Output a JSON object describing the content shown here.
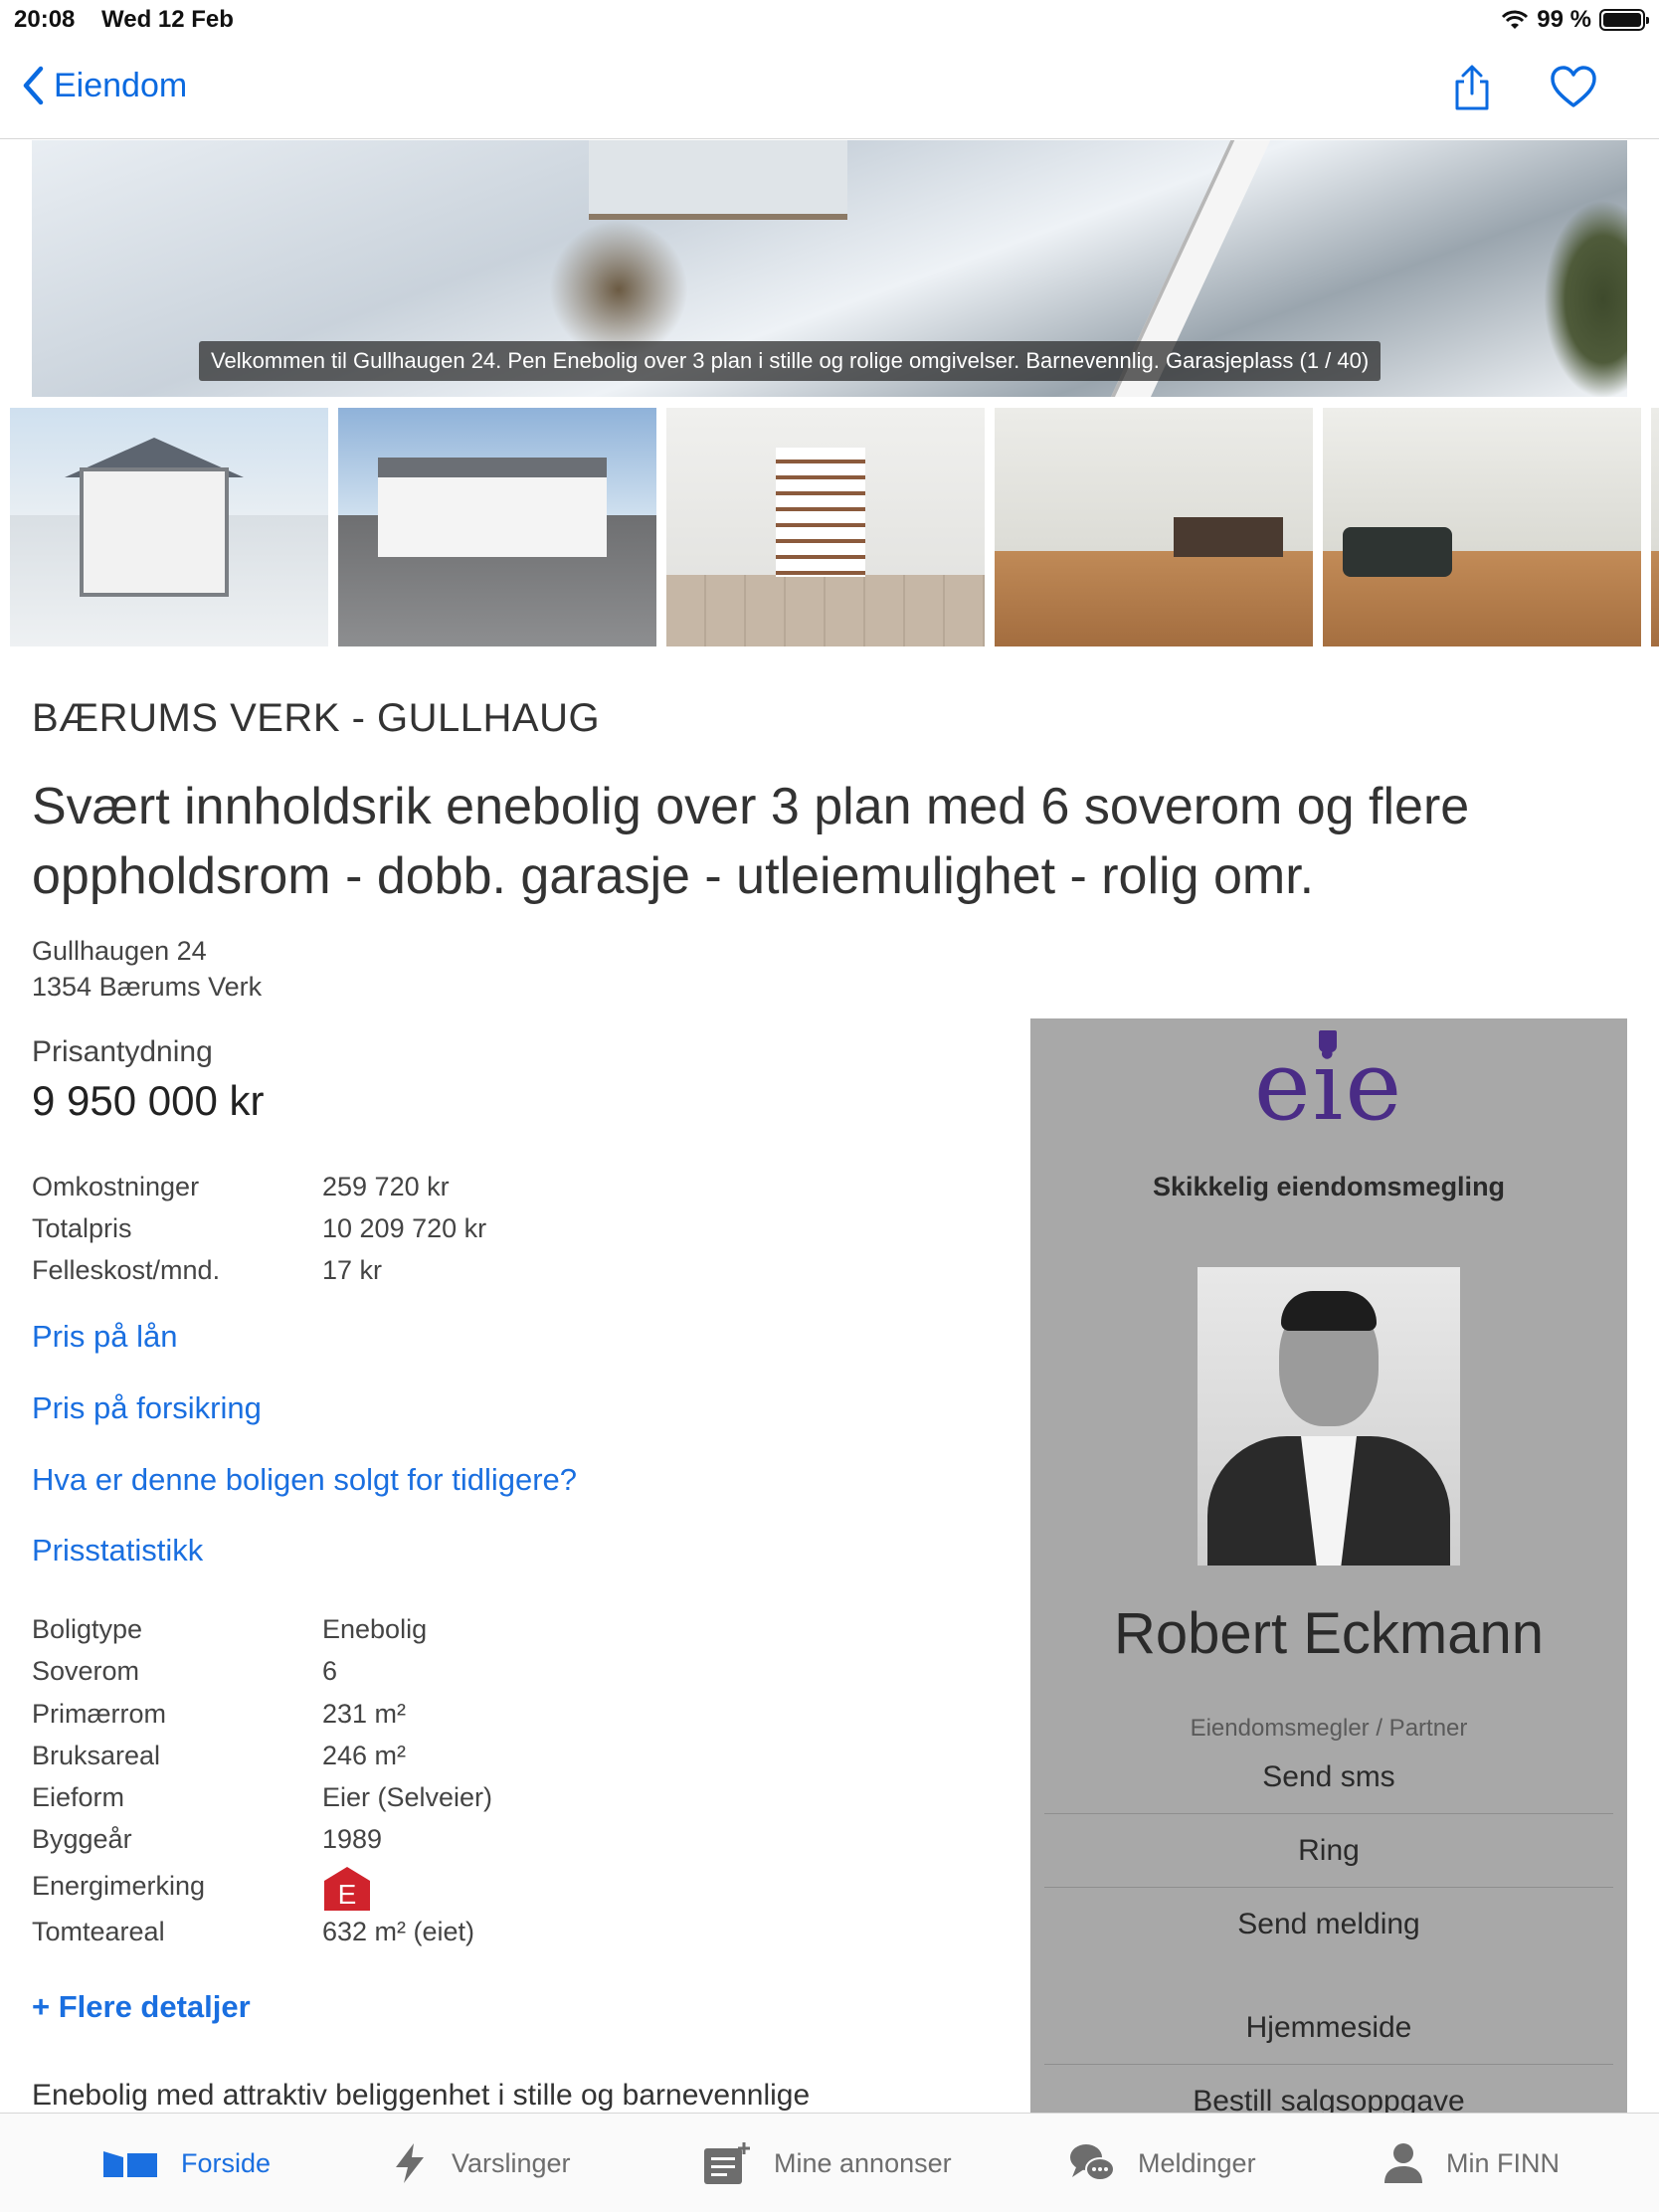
{
  "status_bar": {
    "time": "20:08",
    "date": "Wed 12 Feb",
    "battery": "99 %"
  },
  "nav": {
    "back_label": "Eiendom",
    "icons": [
      "share-icon",
      "heart-icon"
    ]
  },
  "gallery": {
    "caption": "Velkommen til Gullhaugen 24. Pen Enebolig over 3 plan i stille og rolige omgivelser. Barnevennlig. Garasjeplass   (1 / 40)"
  },
  "listing": {
    "location": "BÆRUMS VERK - GULLHAUG",
    "headline_line1": "Svært innholdsrik enebolig over 3 plan med 6 soverom og flere",
    "headline_line2": "oppholdsrom - dobb. garasje - utleiemulighet - rolig omr.",
    "address_line1": "Gullhaugen 24",
    "address_line2": "1354 Bærums Verk",
    "price_label": "Prisantydning",
    "price_value": "9 950 000 kr",
    "costs": [
      {
        "label": "Omkostninger",
        "value": "259 720 kr"
      },
      {
        "label": "Totalpris",
        "value": "10 209 720 kr"
      },
      {
        "label": "Felleskost/mnd.",
        "value": "17 kr"
      }
    ],
    "links": [
      "Pris på lån",
      "Pris på forsikring",
      "Hva er denne boligen solgt for tidligere?",
      "Prisstatistikk"
    ],
    "facts": [
      {
        "label": "Boligtype",
        "value": "Enebolig"
      },
      {
        "label": "Soverom",
        "value": "6"
      },
      {
        "label": "Primærrom",
        "value": "231 m²"
      },
      {
        "label": "Bruksareal",
        "value": "246 m²"
      },
      {
        "label": "Eieform",
        "value": "Eier (Selveier)"
      },
      {
        "label": "Byggeår",
        "value": "1989"
      },
      {
        "label": "Energimerking",
        "value": "E"
      },
      {
        "label": "Tomteareal",
        "value": "632 m² (eiet)"
      }
    ],
    "energy_color": "#d0232c",
    "more_details": "+ Flere detaljer",
    "description_start": "Enebolig med attraktiv beliggenhet i stille og barnevennlige"
  },
  "agent": {
    "logo": "eie",
    "logo_color": "#4a2c86",
    "tagline": "Skikkelig eiendomsmegling",
    "name": "Robert Eckmann",
    "role": "Eiendomsmegler / Partner",
    "actions": [
      "Send sms",
      "Ring",
      "Send melding",
      "Hjemmeside",
      "Bestill salgsoppgave"
    ]
  },
  "tab_bar": {
    "accent": "#1a6fe0",
    "tabs": [
      {
        "label": "Forside",
        "icon": "home-icon",
        "active": true
      },
      {
        "label": "Varslinger",
        "icon": "lightning-icon",
        "active": false
      },
      {
        "label": "Mine annonser",
        "icon": "my-ads-icon",
        "active": false
      },
      {
        "label": "Meldinger",
        "icon": "chat-icon",
        "active": false
      },
      {
        "label": "Min FINN",
        "icon": "person-icon",
        "active": false
      }
    ]
  }
}
